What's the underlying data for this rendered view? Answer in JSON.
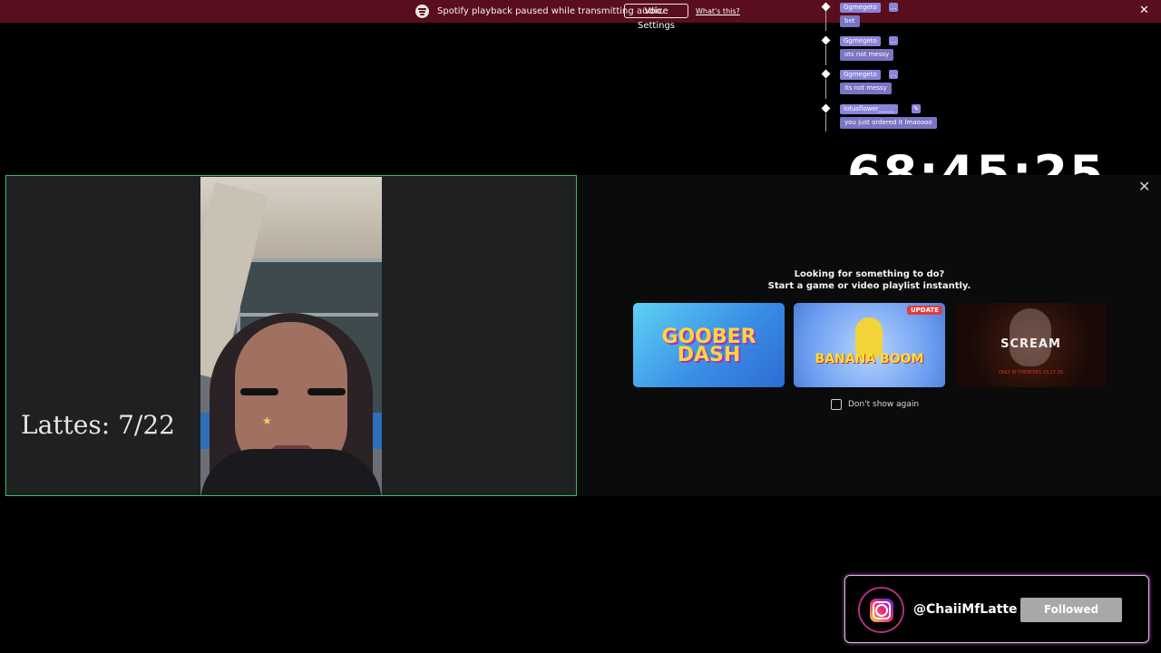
{
  "notification": {
    "message": "Spotify playback paused while transmitting audio.",
    "button_label": "Voice Settings",
    "link_label": "What's this?",
    "close_glyph": "✕",
    "icon": "spotify-icon"
  },
  "chat": {
    "messages": [
      {
        "user": "Ggmegeto",
        "badge": "…",
        "text": "bet"
      },
      {
        "user": "Ggmegeto",
        "badge": "…",
        "text": "ots not messy"
      },
      {
        "user": "Ggmegeto",
        "badge": "…",
        "text": "its not messy"
      },
      {
        "user": "lotusflower_____",
        "badge": "✎",
        "text": "you just ordered it lmaoooo"
      }
    ]
  },
  "timer": {
    "value": "68:45:25"
  },
  "stream": {
    "counter": "Lattes: 7/22"
  },
  "suggestions": {
    "close_glyph": "✕",
    "heading_line1": "Looking for something to do?",
    "heading_line2": "Start a game or video playlist instantly.",
    "tiles": [
      {
        "title": "GOOBER DASH"
      },
      {
        "title": "BANANA BOOM",
        "badge": "UPDATE"
      },
      {
        "title": "SCREAM",
        "subtitle": "ONLY IN THEATRES 03.27.26"
      }
    ],
    "checkbox_label": "Don't show again"
  },
  "social": {
    "handle": "@ChaiiMfLatte",
    "button_label": "Followed",
    "icon": "instagram-icon"
  },
  "colors": {
    "notification_bg": "#5a0d1c",
    "chat_name": "#8b85d9",
    "cam_border": "#3cba6a",
    "ig_border": "#e3b8e6"
  }
}
